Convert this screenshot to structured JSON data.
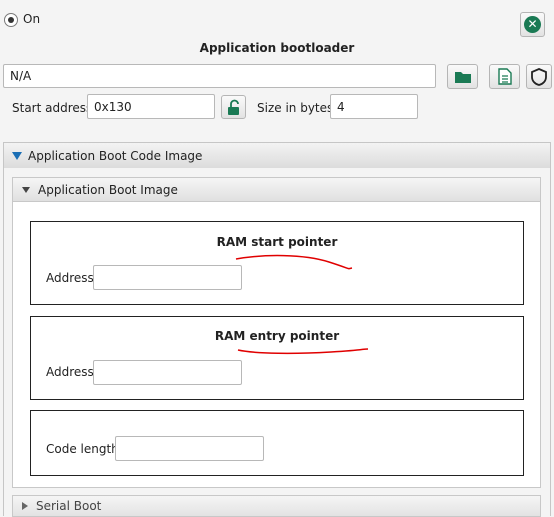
{
  "toggle": {
    "label": "On",
    "selected": true
  },
  "header": {
    "title": "Application bootloader"
  },
  "path": {
    "value": "N/A"
  },
  "fields": {
    "start_address_label": "Start address",
    "start_address_value": "0x130",
    "size_label": "Size in bytes",
    "size_value": "4"
  },
  "sections": {
    "code_image": "Application Boot Code Image",
    "boot_image": "Application Boot Image",
    "serial_boot": "Serial Boot"
  },
  "boxes": {
    "ram_start": {
      "title": "RAM start pointer",
      "label": "Address",
      "value": ""
    },
    "ram_entry": {
      "title": "RAM entry pointer",
      "label": "Address",
      "value": ""
    },
    "code_length": {
      "label": "Code length",
      "value": ""
    }
  },
  "colors": {
    "accent_green": "#1a7a54",
    "accent_blue": "#1b6fb5",
    "annotation_red": "#e00000"
  },
  "icons": {
    "close": "close-circle-icon",
    "folder": "folder-icon",
    "document": "document-icon",
    "shield": "shield-icon",
    "lock": "unlocked-padlock-icon"
  }
}
